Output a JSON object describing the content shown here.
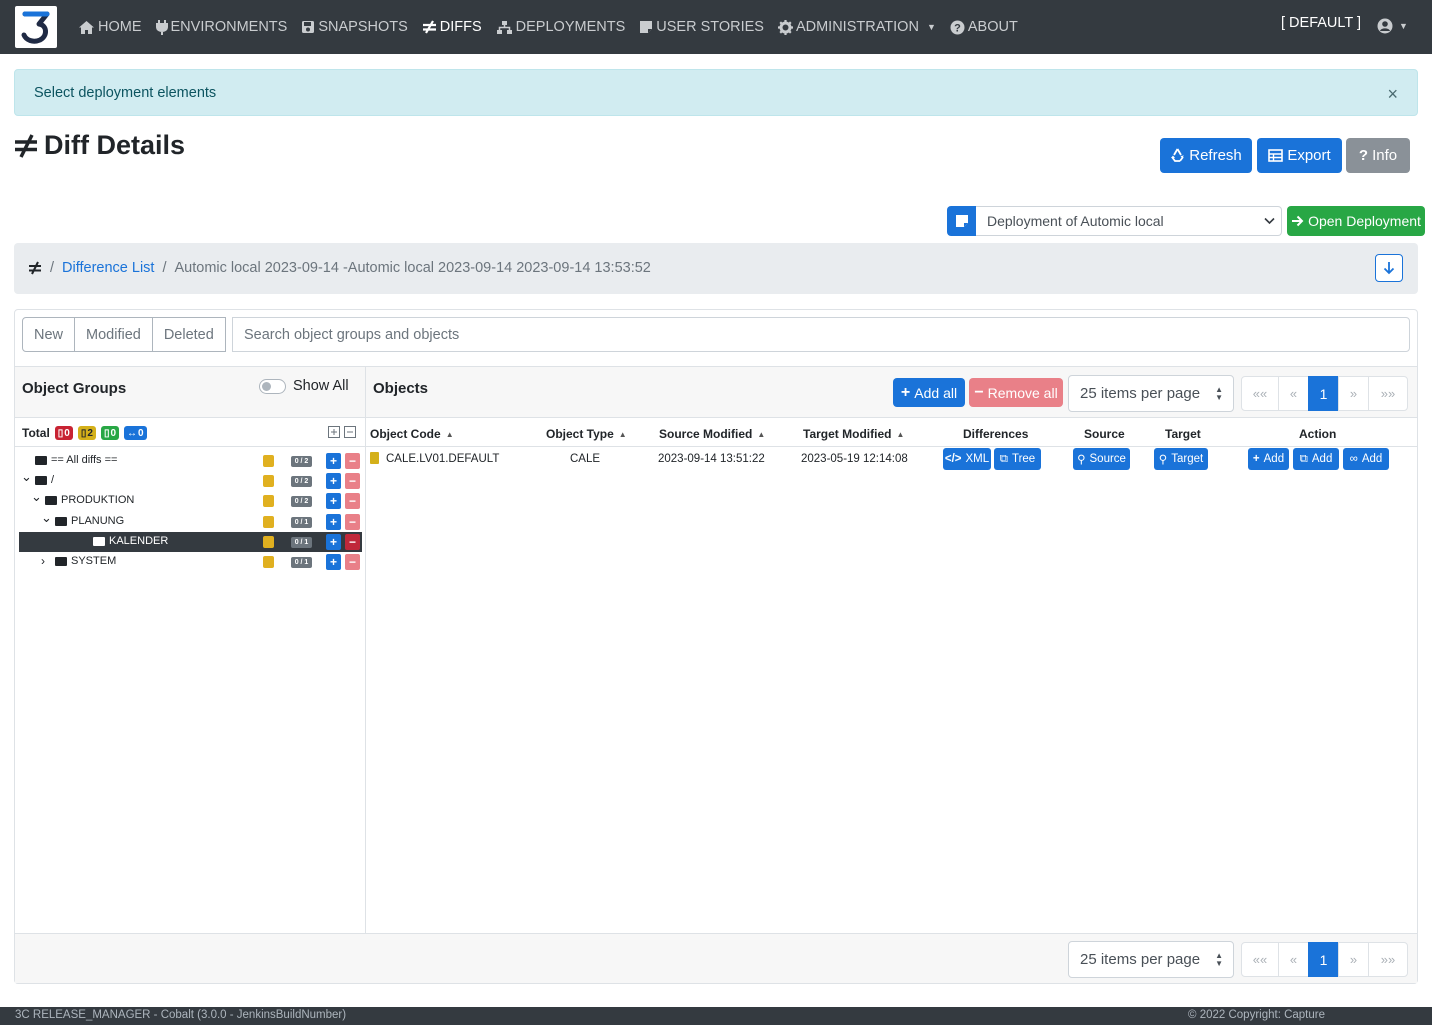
{
  "nav": {
    "items": [
      {
        "label": "HOME",
        "icon": "home-icon"
      },
      {
        "label": "ENVIRONMENTS",
        "icon": "plug-icon"
      },
      {
        "label": "SNAPSHOTS",
        "icon": "save-icon"
      },
      {
        "label": "DIFFS",
        "icon": "not-equal-icon",
        "active": true
      },
      {
        "label": "DEPLOYMENTS",
        "icon": "sitemap-icon"
      },
      {
        "label": "USER STORIES",
        "icon": "sticky-note-icon"
      },
      {
        "label": "ADMINISTRATION",
        "icon": "gear-icon",
        "dropdown": true
      },
      {
        "label": "ABOUT",
        "icon": "question-icon"
      }
    ],
    "environment": "[ DEFAULT ]"
  },
  "alert": {
    "text": "Select deployment elements",
    "close": "×"
  },
  "page": {
    "title": "Diff Details"
  },
  "header_buttons": {
    "refresh": "Refresh",
    "export": "Export",
    "info": "Info"
  },
  "deployment": {
    "selected": "Deployment of Automic local",
    "open_label": "Open Deployment"
  },
  "breadcrumb": {
    "link": "Difference List",
    "current": "Automic local 2023-09-14 -Automic local 2023-09-14 2023-09-14 13:53:52"
  },
  "filters": {
    "new": "New",
    "modified": "Modified",
    "deleted": "Deleted",
    "search_placeholder": "Search object groups and objects"
  },
  "object_groups": {
    "title": "Object Groups",
    "show_all": "Show All",
    "total_label": "Total",
    "totals": {
      "deleted": "0",
      "modified": "2",
      "new": "0",
      "moved": "0"
    },
    "tree": [
      {
        "label": "== All diffs ==",
        "count": "0 / 2",
        "depth": 0,
        "chevron": "",
        "selected": false
      },
      {
        "label": "/",
        "count": "0 / 2",
        "depth": 0,
        "chevron": "down",
        "selected": false
      },
      {
        "label": "PRODUKTION",
        "count": "0 / 2",
        "depth": 1,
        "chevron": "down",
        "selected": false
      },
      {
        "label": "PLANUNG",
        "count": "0 / 1",
        "depth": 2,
        "chevron": "down",
        "selected": false
      },
      {
        "label": "KALENDER",
        "count": "0 / 1",
        "depth": 3,
        "chevron": "",
        "selected": true
      },
      {
        "label": "SYSTEM",
        "count": "0 / 1",
        "depth": 2,
        "chevron": "right",
        "selected": false
      }
    ]
  },
  "objects": {
    "title": "Objects",
    "add_all": "Add all",
    "remove_all": "Remove all",
    "items_per_page": "25 items per page",
    "pager": {
      "first": "«« ",
      "prev": "«",
      "current": "1",
      "next": "»",
      "last": "»»"
    },
    "columns": {
      "code": "Object Code",
      "type": "Object Type",
      "source_modified": "Source Modified",
      "target_modified": "Target Modified",
      "differences": "Differences",
      "source": "Source",
      "target": "Target",
      "action": "Action"
    },
    "rows": [
      {
        "code": "CALE.LV01.DEFAULT",
        "type": "CALE",
        "source_modified": "2023-09-14 13:51:22",
        "target_modified": "2023-05-19 12:14:08",
        "xml_label": "XML",
        "tree_label": "Tree",
        "source_label": "Source",
        "target_label": "Target",
        "add_label": "Add",
        "add_tree_label": "Add",
        "add_linked_label": "Add"
      }
    ]
  },
  "footer": {
    "left": "3C RELEASE_MANAGER - Cobalt (3.0.0 - JenkinsBuildNumber)",
    "right": "© 2022 Copyright: Capture"
  },
  "colors": {
    "primary": "#1a73d9",
    "navbar": "#343a40",
    "alert_bg": "#d1ecf1",
    "success": "#28a745",
    "danger_light": "#e98088"
  }
}
